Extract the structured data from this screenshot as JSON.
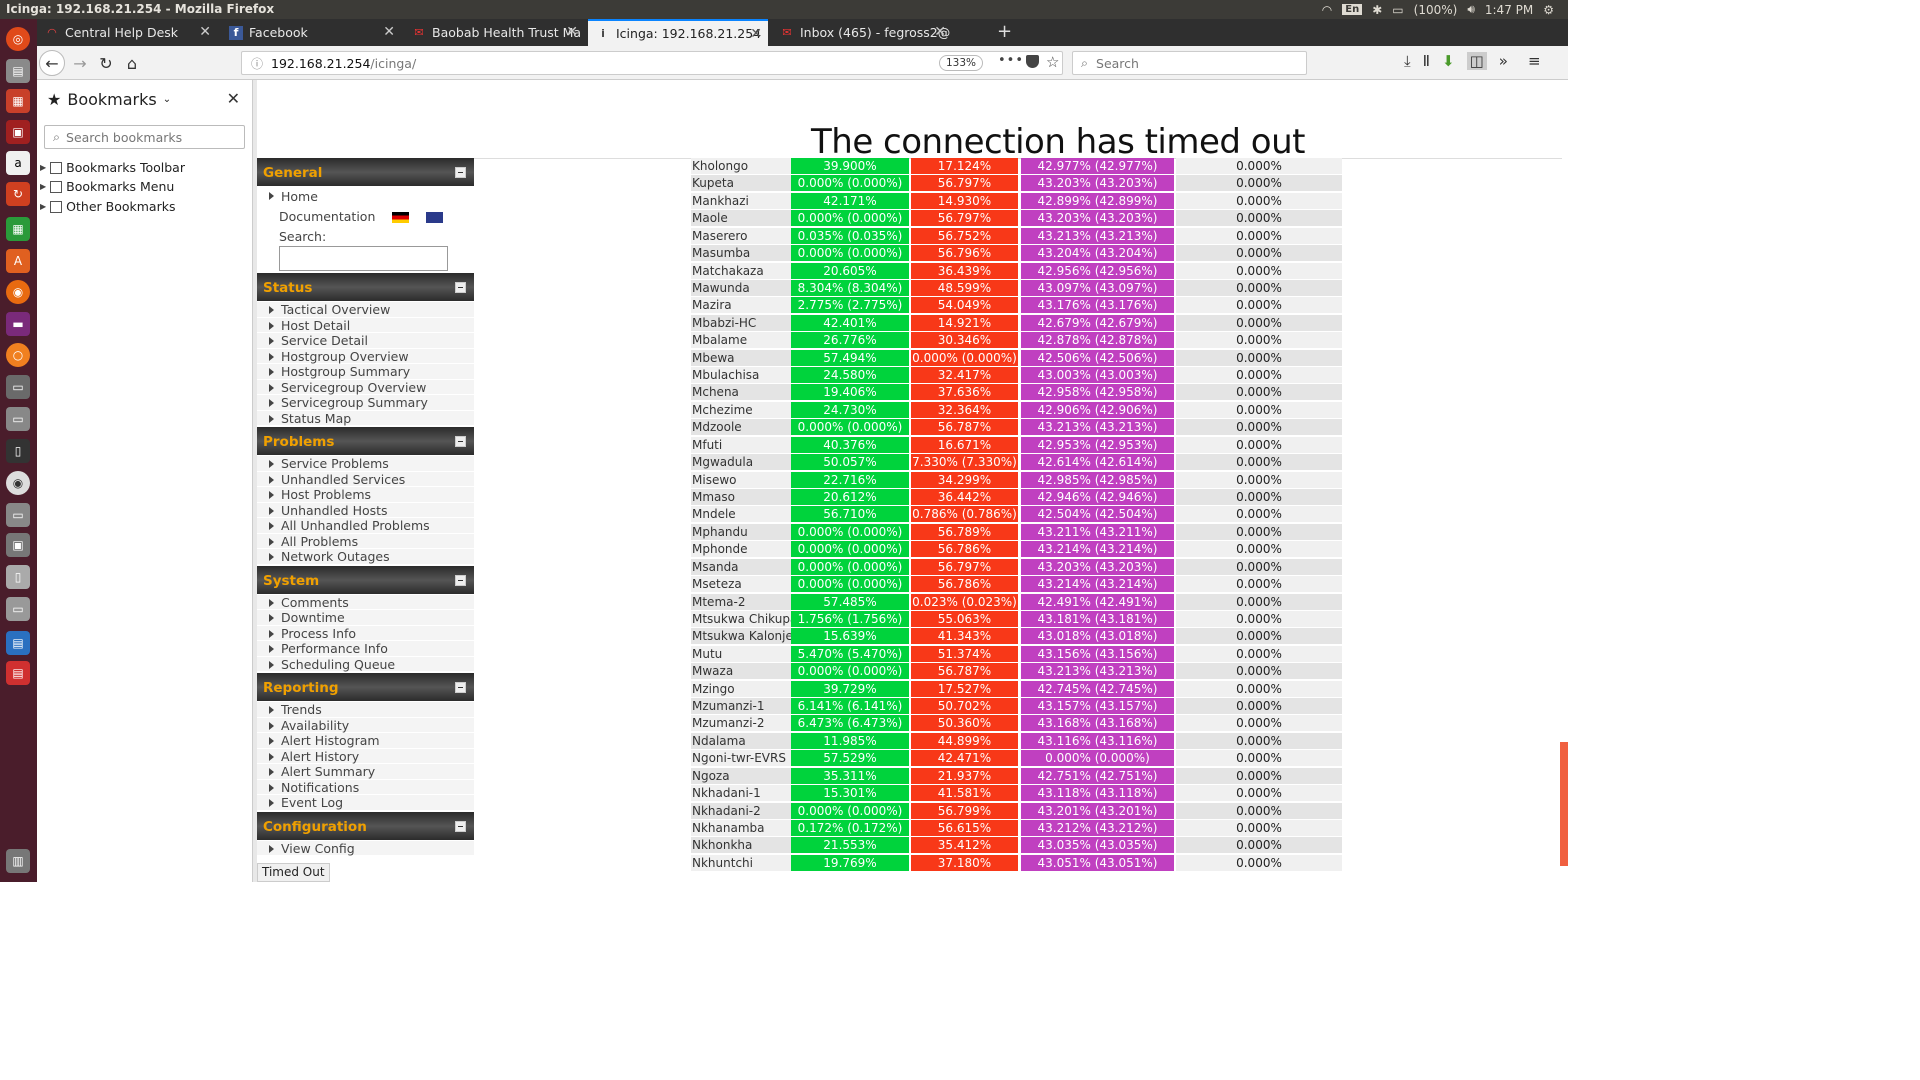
{
  "os": {
    "window_title": "Icinga: 192.168.21.254 - Mozilla Firefox",
    "lang": "En",
    "battery": "(100%)",
    "time": "1:47 PM"
  },
  "tabs": [
    {
      "label": "Central Help Desk",
      "icon": "help-desk-icon"
    },
    {
      "label": "Facebook",
      "icon": "facebook-icon"
    },
    {
      "label": "Baobab Health Trust Ma",
      "icon": "gmail-icon"
    },
    {
      "label": "Icinga: 192.168.21.254",
      "icon": "info-icon"
    },
    {
      "label": "Inbox (465) - fegross2@",
      "icon": "gmail-icon"
    }
  ],
  "nav": {
    "url_host": "192.168.21.254",
    "url_path": "/icinga/",
    "zoom": "133%",
    "search_placeholder": "Search"
  },
  "bookmarks": {
    "title": "Bookmarks",
    "search_placeholder": "Search bookmarks",
    "items": [
      "Bookmarks Toolbar",
      "Bookmarks Menu",
      "Other Bookmarks"
    ]
  },
  "page": {
    "error_title": "The connection has timed out",
    "status": "Timed Out"
  },
  "menu": {
    "general": {
      "title": "General",
      "home": "Home",
      "documentation": "Documentation",
      "search_label": "Search:"
    },
    "status": {
      "title": "Status",
      "items": [
        "Tactical Overview",
        "Host Detail",
        "Service Detail",
        "Hostgroup Overview",
        "Hostgroup Summary",
        "Servicegroup Overview",
        "Servicegroup Summary",
        "Status Map"
      ]
    },
    "problems": {
      "title": "Problems",
      "items": [
        "Service Problems",
        "Unhandled Services",
        "Host Problems",
        "Unhandled Hosts",
        "All Unhandled Problems",
        "All Problems",
        "Network Outages"
      ]
    },
    "system": {
      "title": "System",
      "items": [
        "Comments",
        "Downtime",
        "Process Info",
        "Performance Info",
        "Scheduling Queue"
      ]
    },
    "reporting": {
      "title": "Reporting",
      "items": [
        "Trends",
        "Availability",
        "Alert Histogram",
        "Alert History",
        "Alert Summary",
        "Notifications",
        "Event Log"
      ]
    },
    "configuration": {
      "title": "Configuration",
      "items": [
        "View Config"
      ]
    }
  },
  "table": {
    "colors": {
      "up": "#00d33c",
      "down": "#f83818",
      "unreachable": "#c040c0"
    },
    "rows": [
      {
        "name": "Kholongo",
        "up": "39.900% (39.900%)",
        "down": "17.124% (17.124%)",
        "unreach": "42.977% (42.977%)",
        "undet": "0.000%"
      },
      {
        "name": "Kupeta",
        "up": "0.000% (0.000%)",
        "down": "56.797% (56.797%)",
        "unreach": "43.203% (43.203%)",
        "undet": "0.000%"
      },
      {
        "name": "Mankhazi",
        "up": "42.171% (42.171%)",
        "down": "14.930% (14.930%)",
        "unreach": "42.899% (42.899%)",
        "undet": "0.000%"
      },
      {
        "name": "Maole",
        "up": "0.000% (0.000%)",
        "down": "56.797% (56.797%)",
        "unreach": "43.203% (43.203%)",
        "undet": "0.000%"
      },
      {
        "name": "Maserero",
        "up": "0.035% (0.035%)",
        "down": "56.752% (56.752%)",
        "unreach": "43.213% (43.213%)",
        "undet": "0.000%"
      },
      {
        "name": "Masumba",
        "up": "0.000% (0.000%)",
        "down": "56.796% (56.796%)",
        "unreach": "43.204% (43.204%)",
        "undet": "0.000%"
      },
      {
        "name": "Matchakaza",
        "up": "20.605% (20.605%)",
        "down": "36.439% (36.439%)",
        "unreach": "42.956% (42.956%)",
        "undet": "0.000%"
      },
      {
        "name": "Mawunda",
        "up": "8.304% (8.304%)",
        "down": "48.599% (48.599%)",
        "unreach": "43.097% (43.097%)",
        "undet": "0.000%"
      },
      {
        "name": "Mazira",
        "up": "2.775% (2.775%)",
        "down": "54.049% (54.049%)",
        "unreach": "43.176% (43.176%)",
        "undet": "0.000%"
      },
      {
        "name": "Mbabzi-HC",
        "up": "42.401% (42.401%)",
        "down": "14.921% (14.921%)",
        "unreach": "42.679% (42.679%)",
        "undet": "0.000%"
      },
      {
        "name": "Mbalame",
        "up": "26.776% (26.776%)",
        "down": "30.346% (30.346%)",
        "unreach": "42.878% (42.878%)",
        "undet": "0.000%"
      },
      {
        "name": "Mbewa",
        "up": "57.494% (57.494%)",
        "down": "0.000% (0.000%)",
        "unreach": "42.506% (42.506%)",
        "undet": "0.000%"
      },
      {
        "name": "Mbulachisa",
        "up": "24.580% (24.580%)",
        "down": "32.417% (32.417%)",
        "unreach": "43.003% (43.003%)",
        "undet": "0.000%"
      },
      {
        "name": "Mchena",
        "up": "19.406% (19.406%)",
        "down": "37.636% (37.636%)",
        "unreach": "42.958% (42.958%)",
        "undet": "0.000%"
      },
      {
        "name": "Mchezime",
        "up": "24.730% (24.730%)",
        "down": "32.364% (32.364%)",
        "unreach": "42.906% (42.906%)",
        "undet": "0.000%"
      },
      {
        "name": "Mdzoole",
        "up": "0.000% (0.000%)",
        "down": "56.787% (56.787%)",
        "unreach": "43.213% (43.213%)",
        "undet": "0.000%"
      },
      {
        "name": "Mfuti",
        "up": "40.376% (40.376%)",
        "down": "16.671% (16.671%)",
        "unreach": "42.953% (42.953%)",
        "undet": "0.000%"
      },
      {
        "name": "Mgwadula",
        "up": "50.057% (50.057%)",
        "down": "7.330% (7.330%)",
        "unreach": "42.614% (42.614%)",
        "undet": "0.000%"
      },
      {
        "name": "Misewo",
        "up": "22.716% (22.716%)",
        "down": "34.299% (34.299%)",
        "unreach": "42.985% (42.985%)",
        "undet": "0.000%"
      },
      {
        "name": "Mmaso",
        "up": "20.612% (20.612%)",
        "down": "36.442% (36.442%)",
        "unreach": "42.946% (42.946%)",
        "undet": "0.000%"
      },
      {
        "name": "Mndele",
        "up": "56.710% (56.710%)",
        "down": "0.786% (0.786%)",
        "unreach": "42.504% (42.504%)",
        "undet": "0.000%"
      },
      {
        "name": "Mphandu",
        "up": "0.000% (0.000%)",
        "down": "56.789% (56.789%)",
        "unreach": "43.211% (43.211%)",
        "undet": "0.000%"
      },
      {
        "name": "Mphonde",
        "up": "0.000% (0.000%)",
        "down": "56.786% (56.786%)",
        "unreach": "43.214% (43.214%)",
        "undet": "0.000%"
      },
      {
        "name": "Msanda",
        "up": "0.000% (0.000%)",
        "down": "56.797% (56.797%)",
        "unreach": "43.203% (43.203%)",
        "undet": "0.000%"
      },
      {
        "name": "Mseteza",
        "up": "0.000% (0.000%)",
        "down": "56.786% (56.786%)",
        "unreach": "43.214% (43.214%)",
        "undet": "0.000%"
      },
      {
        "name": "Mtema-2",
        "up": "57.485% (57.485%)",
        "down": "0.023% (0.023%)",
        "unreach": "42.491% (42.491%)",
        "undet": "0.000%"
      },
      {
        "name": "Mtsukwa Chikupa",
        "up": "1.756% (1.756%)",
        "down": "55.063% (55.063%)",
        "unreach": "43.181% (43.181%)",
        "undet": "0.000%"
      },
      {
        "name": "Mtsukwa Kalonje",
        "up": "15.639% (15.639%)",
        "down": "41.343% (41.343%)",
        "unreach": "43.018% (43.018%)",
        "undet": "0.000%"
      },
      {
        "name": "Mutu",
        "up": "5.470% (5.470%)",
        "down": "51.374% (51.374%)",
        "unreach": "43.156% (43.156%)",
        "undet": "0.000%"
      },
      {
        "name": "Mwaza",
        "up": "0.000% (0.000%)",
        "down": "56.787% (56.787%)",
        "unreach": "43.213% (43.213%)",
        "undet": "0.000%"
      },
      {
        "name": "Mzingo",
        "up": "39.729% (39.729%)",
        "down": "17.527% (17.527%)",
        "unreach": "42.745% (42.745%)",
        "undet": "0.000%"
      },
      {
        "name": "Mzumanzi-1",
        "up": "6.141% (6.141%)",
        "down": "50.702% (50.702%)",
        "unreach": "43.157% (43.157%)",
        "undet": "0.000%"
      },
      {
        "name": "Mzumanzi-2",
        "up": "6.473% (6.473%)",
        "down": "50.360% (50.360%)",
        "unreach": "43.168% (43.168%)",
        "undet": "0.000%"
      },
      {
        "name": "Ndalama",
        "up": "11.985% (11.985%)",
        "down": "44.899% (44.899%)",
        "unreach": "43.116% (43.116%)",
        "undet": "0.000%"
      },
      {
        "name": "Ngoni-twr-EVRS",
        "up": "57.529% (57.529%)",
        "down": "42.471% (42.471%)",
        "unreach": "0.000% (0.000%)",
        "undet": "0.000%"
      },
      {
        "name": "Ngoza",
        "up": "35.311% (35.311%)",
        "down": "21.937% (21.937%)",
        "unreach": "42.751% (42.751%)",
        "undet": "0.000%"
      },
      {
        "name": "Nkhadani-1",
        "up": "15.301% (15.301%)",
        "down": "41.581% (41.581%)",
        "unreach": "43.118% (43.118%)",
        "undet": "0.000%"
      },
      {
        "name": "Nkhadani-2",
        "up": "0.000% (0.000%)",
        "down": "56.799% (56.799%)",
        "unreach": "43.201% (43.201%)",
        "undet": "0.000%"
      },
      {
        "name": "Nkhanamba",
        "up": "0.172% (0.172%)",
        "down": "56.615% (56.615%)",
        "unreach": "43.212% (43.212%)",
        "undet": "0.000%"
      },
      {
        "name": "Nkhonkha",
        "up": "21.553% (21.553%)",
        "down": "35.412% (35.412%)",
        "unreach": "43.035% (43.035%)",
        "undet": "0.000%"
      },
      {
        "name": "Nkhuntchi",
        "up": "19.769% (19.769%)",
        "down": "37.180% (37.180%)",
        "unreach": "43.051% (43.051%)",
        "undet": "0.000%"
      }
    ]
  }
}
